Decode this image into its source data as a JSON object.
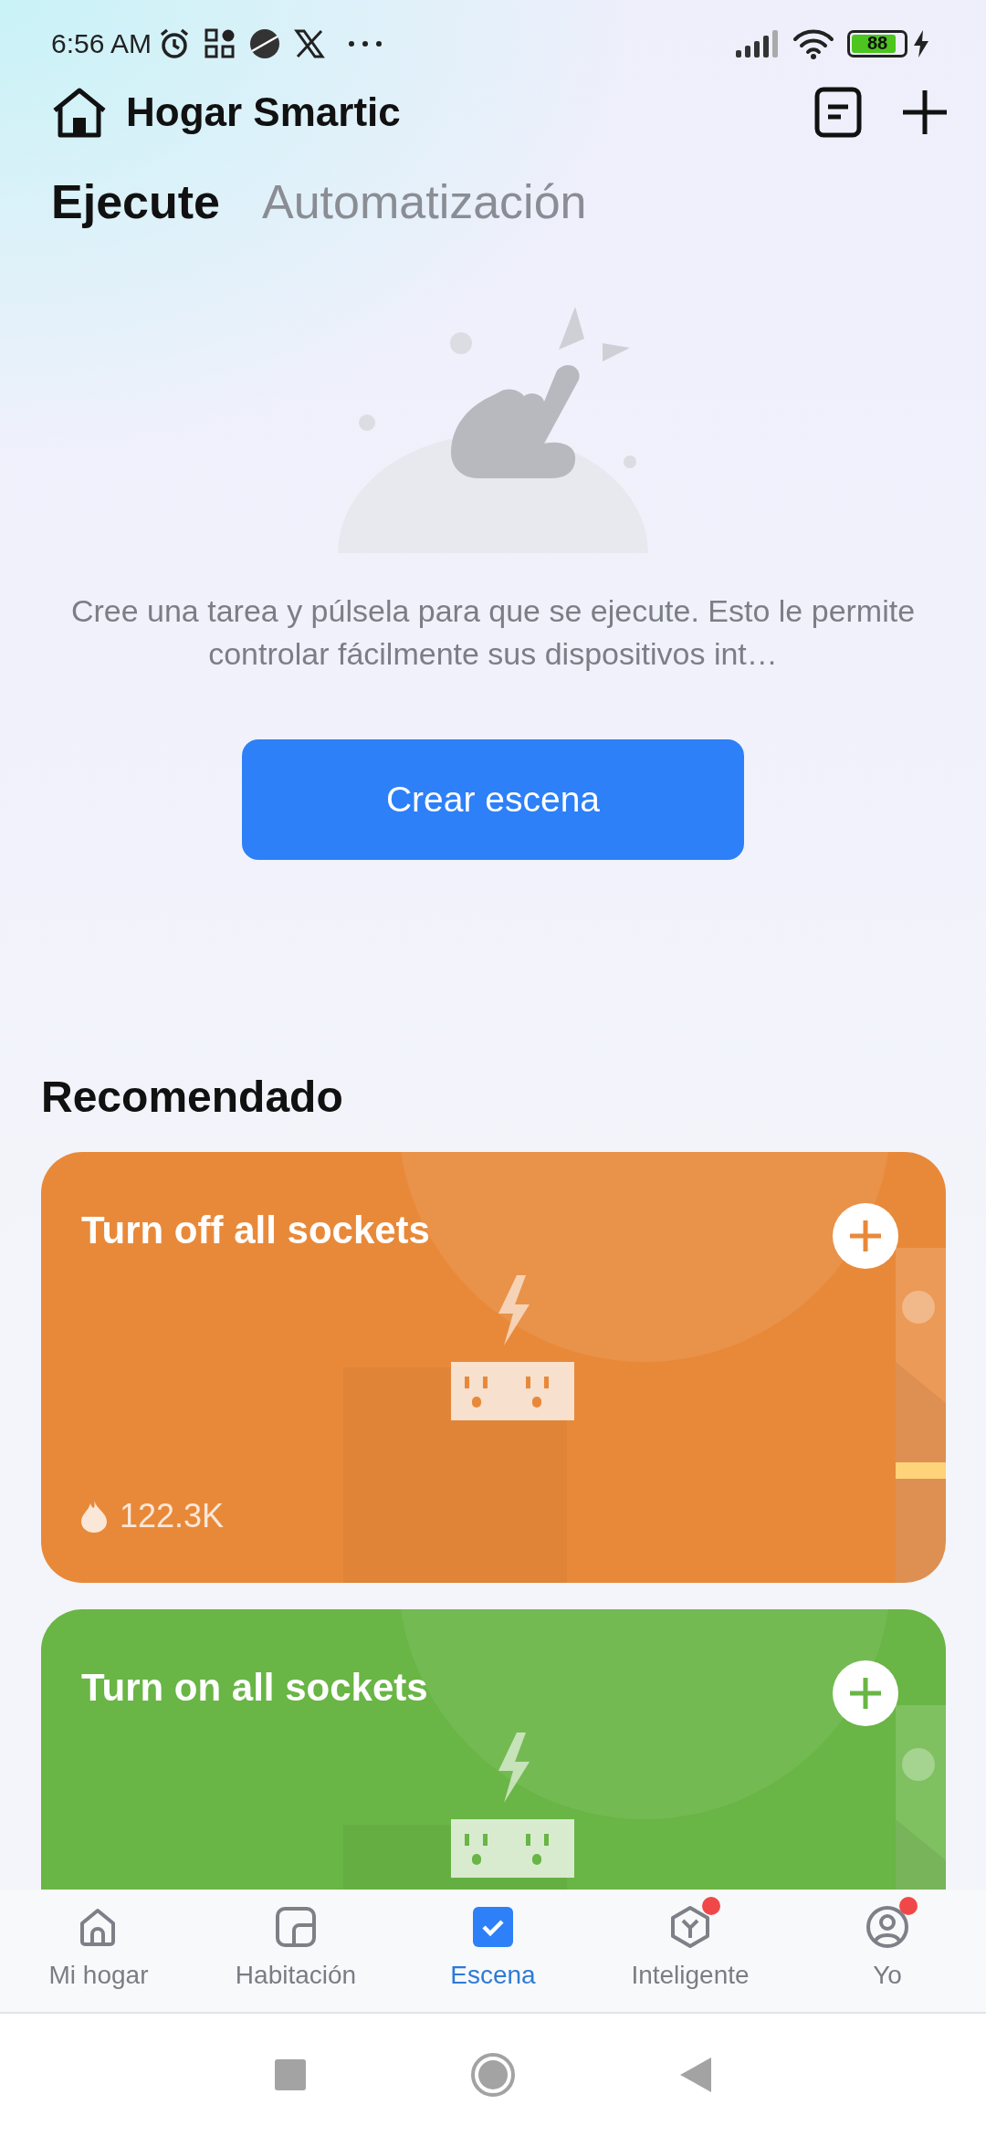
{
  "status_bar": {
    "time": "6:56 AM",
    "battery": "88"
  },
  "header": {
    "title": "Hogar Smartic"
  },
  "tabs": [
    {
      "label": "Ejecute",
      "selected": true
    },
    {
      "label": "Automatización",
      "selected": false
    }
  ],
  "empty_state": {
    "message": "Cree una tarea y púlsela para que se ejecute. Esto le permite controlar fácilmente sus dispositivos int…",
    "button": "Crear escena"
  },
  "recommended": {
    "title": "Recomendado",
    "cards": [
      {
        "title": "Turn off all sockets",
        "count": "122.3K",
        "color": "#e8893a"
      },
      {
        "title": "Turn on all sockets",
        "color": "#69b545"
      }
    ]
  },
  "bottom_nav": [
    {
      "label": "Mi hogar",
      "selected": false,
      "badge": false
    },
    {
      "label": "Habitación",
      "selected": false,
      "badge": false
    },
    {
      "label": "Escena",
      "selected": true,
      "badge": false
    },
    {
      "label": "Inteligente",
      "selected": false,
      "badge": true
    },
    {
      "label": "Yo",
      "selected": false,
      "badge": true
    }
  ]
}
